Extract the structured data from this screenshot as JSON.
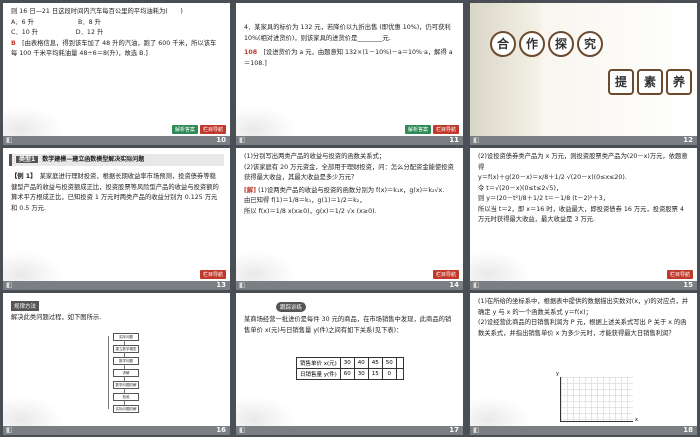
{
  "slides": [
    {
      "number": "10",
      "lines": [
        "则 16 日—21 日这段时间内汽车每百公里的平均油耗为(　　)",
        "A．6 升　　　　　　　B．8 升",
        "C．10 升　　　　　　D．12 升"
      ],
      "answer_label": "B",
      "answer_text": "[由表格信息，得到该车加了 48 升的汽油，跑了 600 千米，所以该车每 100 千米平均耗油量 48÷6＝8(升)，故选 B.]",
      "btn1": "解析答案",
      "btn2": "栏目导航"
    },
    {
      "number": "11",
      "lines": [
        "4．某家具的标价为 132 元，若降价以九折出售 (即优惠 10%)，仍可获利 10%(相对进货价)，则该家具的进货价是________元."
      ],
      "answer_label": "108",
      "answer_text": "[设进货价为 a 元，由题意知 132×(1－10%)－a＝10%·a，解得 a＝108.]",
      "btn1": "解析答案",
      "btn2": "栏目导航"
    },
    {
      "number": "12",
      "circles": [
        "合",
        "作",
        "探",
        "究"
      ],
      "circles2": [
        "提",
        "素",
        "养"
      ]
    },
    {
      "number": "13",
      "tag": "类型1",
      "title": "数学建模—建立函数模型解决实际问题",
      "label": "【例 1】",
      "text": "某家庭进行理财投资，根据长期收益率市场预测，投资债券等稳健型产品的收益与投资额成正比，投资股票等风险型产品的收益与投资额的算术平方根成正比，已知投资 1 万元时两类产品的收益分别为 0.125 万元和 0.5 万元.",
      "btn2": "栏目导航"
    },
    {
      "number": "14",
      "lines": [
        "(1)分别写出两类产品的收益与投资的函数关系式；",
        "(2)该家庭有 20 万元资金，全部用于理财投资，问：怎么分配资金能使投资获得最大收益，其最大收益是多少万元？"
      ],
      "answer_label": "[解]",
      "answer_lines": [
        "(1)设两类产品的收益与投资的函数分别为 f(x)＝k₁x，g(x)＝k₂√x.",
        "由已知得 f(1)＝1/8＝k₁，g(1)＝1/2＝k₂，",
        "所以 f(x)＝1/8 x(x≥0)，g(x)＝1/2 √x (x≥0)."
      ],
      "btn2": "栏目导航"
    },
    {
      "number": "15",
      "lines": [
        "(2)设投资债券类产品为 x 万元，则投资股票类产品为(20－x)万元，依题意得",
        "y＝f(x)＋g(20－x)＝x/8＋1/2 √(20－x)(0≤x≤20).",
        "令 t＝√(20－x)(0≤t≤2√5)，",
        "则 y＝(20－t²)/8＋1/2 t＝－1/8 (t－2)²＋3，",
        "所以当 t＝2，即 x＝16 时，收益最大，即投资债券 16 万元，投资股票 4 万元时获得最大收益，最大收益是 3 万元."
      ],
      "btn2": "栏目导航"
    },
    {
      "number": "16",
      "tag": "规律方法",
      "text": "解决此类问题过程，如下图所示.",
      "flow": [
        "实际问题",
        "建立数学模型",
        "数学问题",
        "求解",
        "数学问题的解",
        "检验",
        "实际问题的解"
      ]
    },
    {
      "number": "17",
      "tag": "跟踪训练",
      "text": "某商场经营一批进价是每件 30 元的商品，在市场销售中发现，此商品的销售单价 x(元)与日销售量 y(件)之间有如下关系(见下表)：",
      "table": {
        "row1_head": "销售单价 x(元)",
        "row1": [
          "30",
          "40",
          "45",
          "50"
        ],
        "row2_head": "日销售量 y(件)",
        "row2": [
          "60",
          "30",
          "15",
          "0"
        ]
      }
    },
    {
      "number": "18",
      "lines": [
        "(1)在所给的坐标系中，根据表中提供的数据描出实数对(x，y)的对应点，并确定 y 与 x 的一个函数关系式 y＝f(x)；",
        "(2)设经营此商品的日销售利润为 P 元，根据上述关系式写出 P 关于 x 的函数关系式，并指出销售单价 x 为多少元时，才能获得最大日销售利润？"
      ],
      "axis_x": "x",
      "axis_y": "y"
    }
  ]
}
